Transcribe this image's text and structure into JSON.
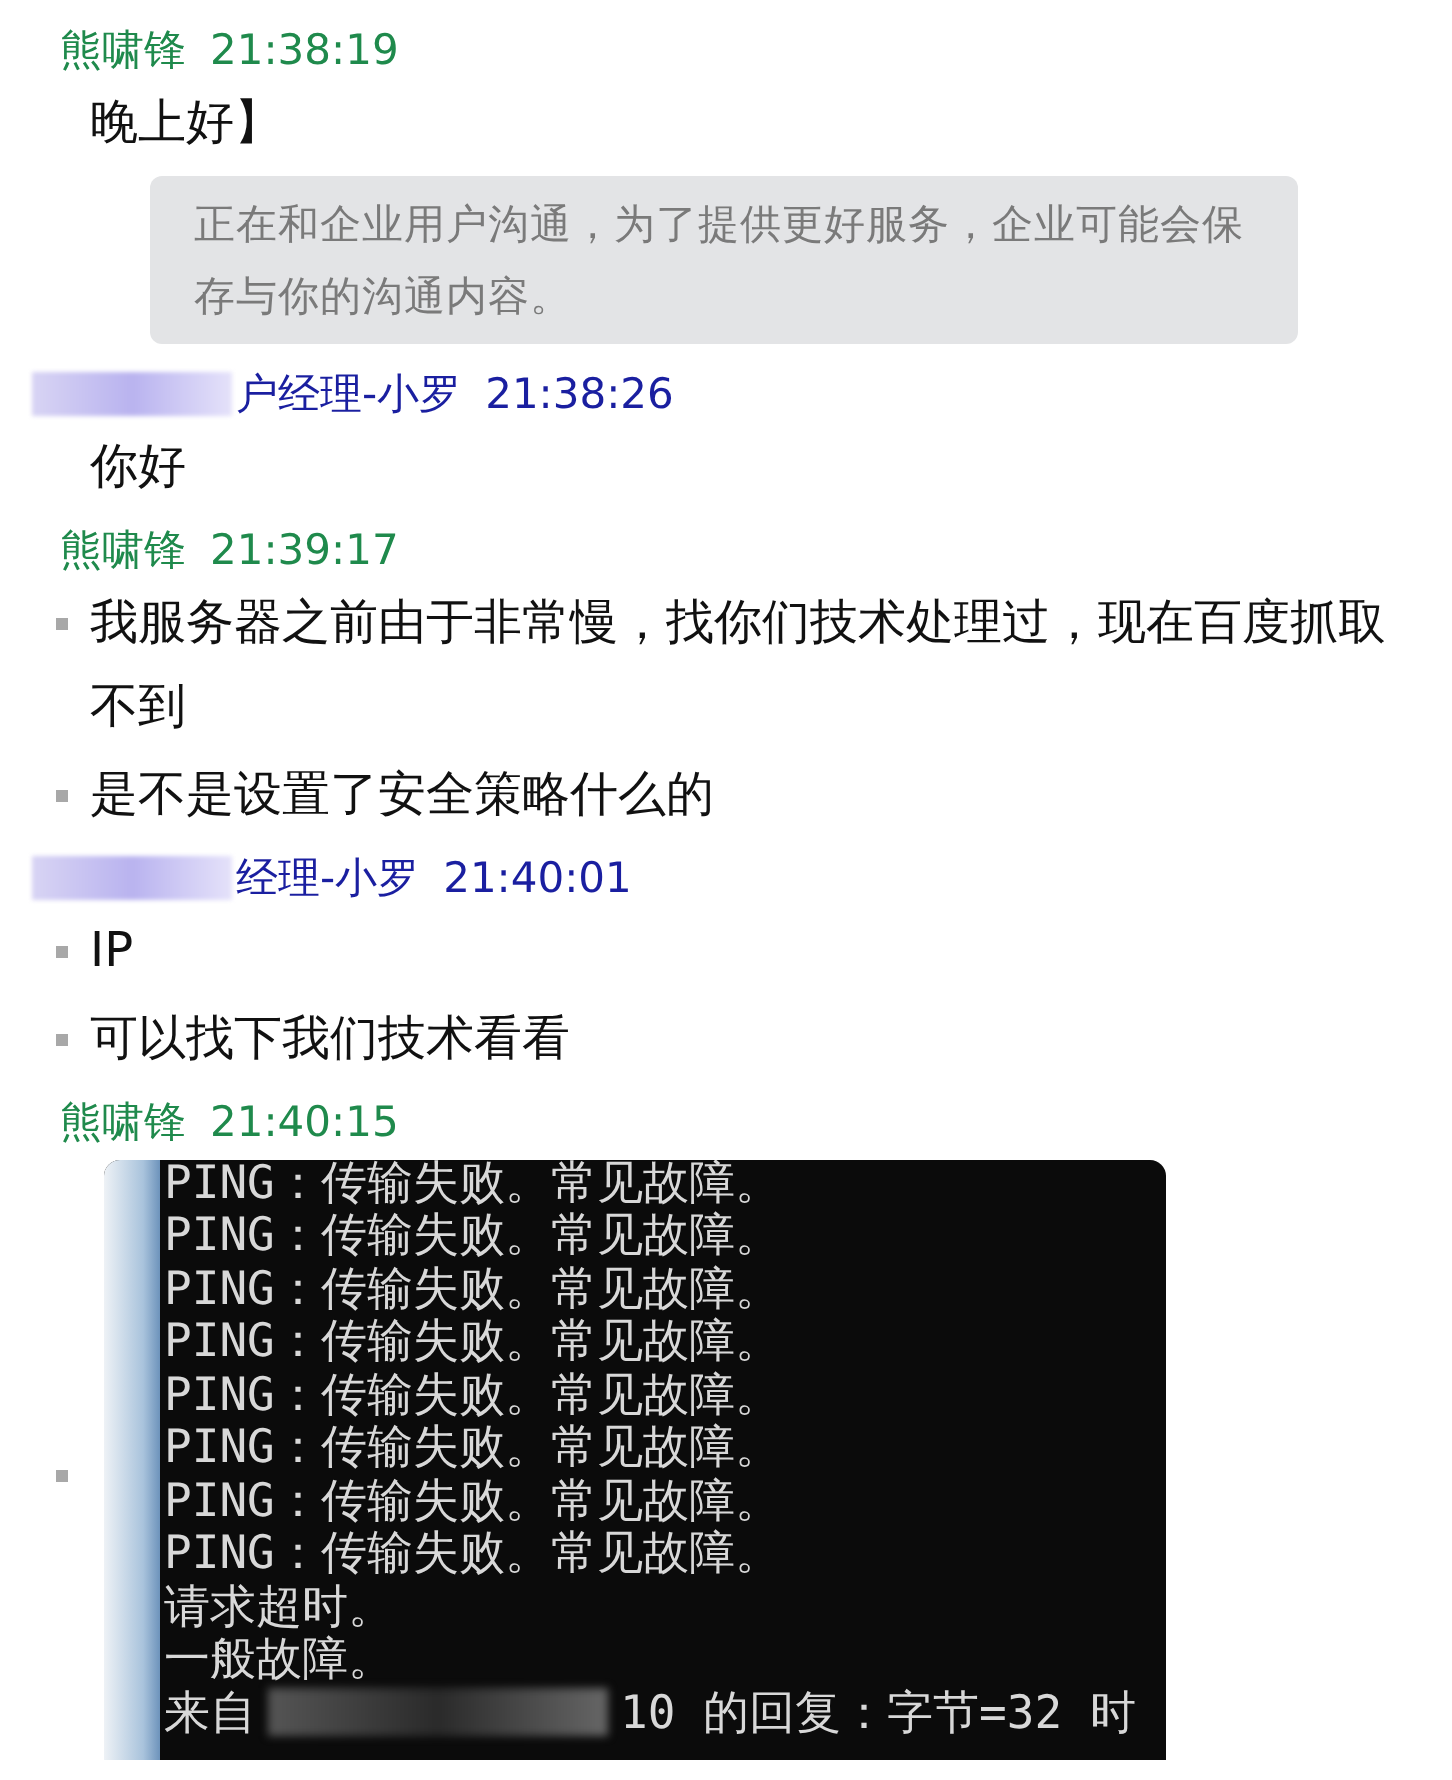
{
  "messages_groups": [
    {
      "sender": {
        "kind": "self",
        "name": "熊啸锋",
        "time": "21:38:19",
        "redacted": false
      },
      "messages": [
        {
          "kind": "text",
          "bullet": false,
          "text": "晚上好】"
        },
        {
          "kind": "notice",
          "bullet": false,
          "text": "正在和企业用户沟通，为了提供更好服务，企业可能会保存与你的沟通内容。"
        }
      ]
    },
    {
      "sender": {
        "kind": "agent",
        "name": "户经理-小罗",
        "time": "21:38:26",
        "redacted": true
      },
      "messages": [
        {
          "kind": "text",
          "bullet": false,
          "text": "你好"
        }
      ]
    },
    {
      "sender": {
        "kind": "self",
        "name": "熊啸锋",
        "time": "21:39:17",
        "redacted": false
      },
      "messages": [
        {
          "kind": "text",
          "bullet": true,
          "text": "我服务器之前由于非常慢，找你们技术处理过，现在百度抓取不到"
        },
        {
          "kind": "text",
          "bullet": true,
          "text": "是不是设置了安全策略什么的"
        }
      ]
    },
    {
      "sender": {
        "kind": "agent",
        "name": "经理-小罗",
        "time": "21:40:01",
        "redacted": true
      },
      "messages": [
        {
          "kind": "text",
          "bullet": true,
          "text": "IP"
        },
        {
          "kind": "text",
          "bullet": true,
          "text": "可以找下我们技术看看"
        }
      ]
    },
    {
      "sender": {
        "kind": "self",
        "name": "熊啸锋",
        "time": "21:40:15",
        "redacted": false
      },
      "messages": [
        {
          "kind": "screenshot",
          "bullet": true,
          "lines": [
            {
              "text": "PING：传输失败。常见故障。"
            },
            {
              "text": "PING：传输失败。常见故障。"
            },
            {
              "text": "PING：传输失败。常见故障。"
            },
            {
              "text": "PING：传输失败。常见故障。"
            },
            {
              "text": "PING：传输失败。常见故障。"
            },
            {
              "text": "PING：传输失败。常见故障。"
            },
            {
              "text": "PING：传输失败。常见故障。"
            },
            {
              "text": "PING：传输失败。常见故障。"
            },
            {
              "text": "请求超时。"
            },
            {
              "text": "一般故障。"
            },
            {
              "text": "来自",
              "redacted_after": "10 的回复：字节=32 时"
            }
          ]
        }
      ]
    }
  ]
}
